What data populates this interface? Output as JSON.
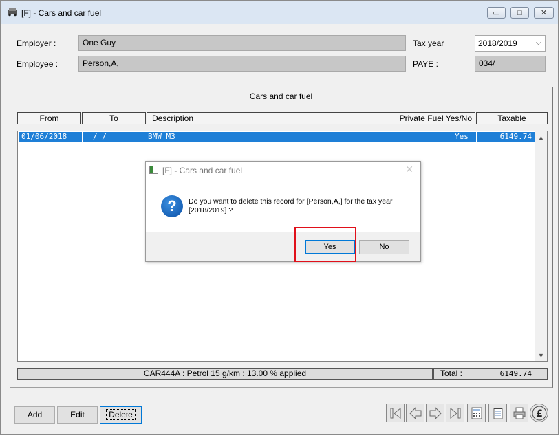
{
  "window": {
    "title": "[F] - Cars and car fuel",
    "min_glyph": "▭",
    "max_glyph": "□",
    "close_glyph": "✕"
  },
  "header": {
    "employer_label": "Employer :",
    "employer_value": "One Guy",
    "employee_label": "Employee :",
    "employee_value": "Person,A,",
    "tax_year_label": "Tax year",
    "tax_year_value": "2018/2019",
    "paye_label": "PAYE :",
    "paye_value": "034/"
  },
  "panel": {
    "title": "Cars and car fuel",
    "columns": {
      "from": "From",
      "to": "To",
      "description": "Description",
      "private_fuel": "Private Fuel Yes/No",
      "taxable": "Taxable"
    },
    "rows": [
      {
        "from": "01/06/2018",
        "to": "/  /",
        "description": "BMW M3",
        "private_fuel": "Yes",
        "taxable": "6149.74"
      }
    ],
    "status_text": "CAR444A : Petrol 15 g/km : 13.00 % applied",
    "total_label": "Total :",
    "total_value": "6149.74"
  },
  "buttons": {
    "add": "Add",
    "edit": "Edit",
    "delete": "Delete"
  },
  "nav_icons": [
    "first-icon",
    "prev-icon",
    "next-icon",
    "last-icon",
    "calculator-icon",
    "notepad-icon",
    "print-icon",
    "pound-icon"
  ],
  "dialog": {
    "title": "[F] - Cars and car fuel",
    "message": "Do you want to delete this record for [Person,A,] for the tax year [2018/2019] ?",
    "yes": "Yes",
    "no": "No",
    "close_glyph": "✕"
  },
  "colors": {
    "selection": "#1e7fd7",
    "highlight_box": "#e0101a"
  }
}
